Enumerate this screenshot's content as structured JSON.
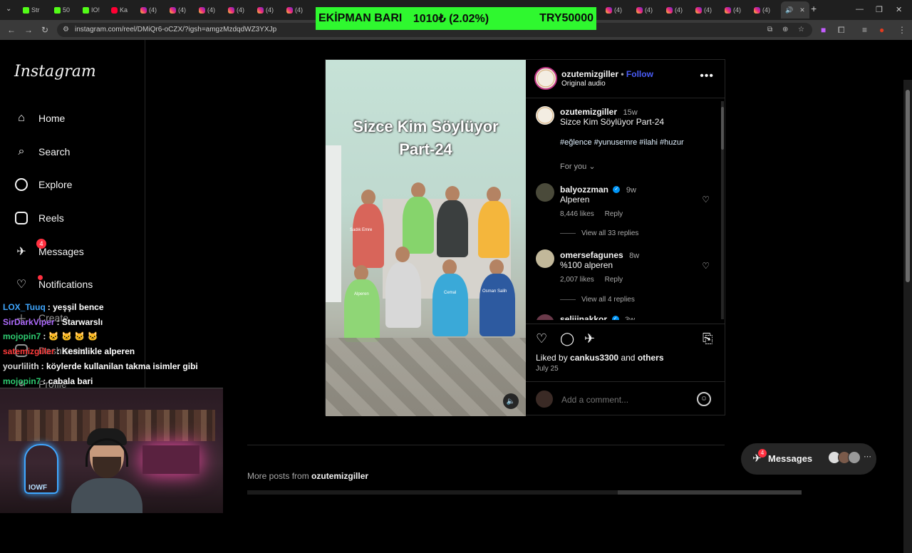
{
  "browser": {
    "tabs": [
      {
        "label": "Str",
        "icon": "kick"
      },
      {
        "label": "50",
        "icon": "kick"
      },
      {
        "label": "IO!",
        "icon": "kick"
      },
      {
        "label": "Ka",
        "icon": "youtube"
      },
      {
        "label": "(4)",
        "icon": "instagram"
      },
      {
        "label": "(4)",
        "icon": "instagram"
      },
      {
        "label": "(4)",
        "icon": "instagram"
      },
      {
        "label": "(4)",
        "icon": "instagram"
      },
      {
        "label": "(4)",
        "icon": "instagram"
      },
      {
        "label": "(4)",
        "icon": "instagram"
      },
      {
        "label": "(4)",
        "icon": "instagram"
      },
      {
        "label": "(4)",
        "icon": "instagram"
      },
      {
        "label": "(4)",
        "icon": "instagram"
      },
      {
        "label": "(4)",
        "icon": "instagram"
      },
      {
        "label": "(4)",
        "icon": "instagram"
      },
      {
        "label": "(4)",
        "icon": "instagram"
      }
    ],
    "url": "instagram.com/reel/DMiQr6-oCZX/?igsh=amgzMzdqdWZ3YXJp",
    "new_tab": "+",
    "minimize": "—",
    "restore": "❐",
    "close": "✕"
  },
  "ticker": {
    "label": "EKİPMAN BARI",
    "amount": "1010₺ (2.02%)",
    "goal": "TRY50000"
  },
  "sidebar": {
    "logo": "Instagram",
    "items": [
      {
        "label": "Home",
        "icon": "home-icon"
      },
      {
        "label": "Search",
        "icon": "search-icon"
      },
      {
        "label": "Explore",
        "icon": "compass-icon"
      },
      {
        "label": "Reels",
        "icon": "reels-icon"
      },
      {
        "label": "Messages",
        "icon": "messenger-icon",
        "badge": "4"
      },
      {
        "label": "Notifications",
        "icon": "heart-icon"
      },
      {
        "label": "Create",
        "icon": "plus-icon"
      },
      {
        "label": "Dashboard",
        "icon": "dashboard-icon"
      },
      {
        "label": "Profile",
        "icon": "profile-icon"
      }
    ]
  },
  "post": {
    "video_title_line1": "Sizce Kim Söylüyor",
    "video_title_line2": "Part-24",
    "kid_names": [
      "Sadık Emre",
      "Alperen",
      "Cemal",
      "Osman Salih"
    ],
    "author": "ozutemizgiller",
    "follow": "Follow",
    "audio": "Original audio",
    "caption": {
      "user": "ozutemizgiller",
      "time": "15w",
      "text": "Sizce Kim Söylüyor Part-24",
      "tags": "#eğlence #yunusemre #ilahi #huzur",
      "for_you": "For you"
    },
    "comments": [
      {
        "user": "balyozzman",
        "verified": true,
        "time": "9w",
        "text": "Alperen",
        "likes": "8,446 likes",
        "reply": "Reply",
        "view_replies": "View all 33 replies"
      },
      {
        "user": "omersefagunes",
        "verified": false,
        "time": "8w",
        "text": "%100 alperen",
        "likes": "2,007 likes",
        "reply": "Reply",
        "view_replies": "View all 4 replies"
      },
      {
        "user": "seliiinakkor",
        "verified": true,
        "time": "3w",
        "text": "",
        "likes": "",
        "reply": "",
        "view_replies": ""
      }
    ],
    "liked_by_prefix": "Liked by",
    "liked_by_user": "cankus3300",
    "liked_by_suffix": "and",
    "liked_by_others": "others",
    "date": "July 25",
    "add_comment_placeholder": "Add a comment..."
  },
  "more_posts": {
    "prefix": "More posts from",
    "user": "ozutemizgiller"
  },
  "messages_bar": {
    "label": "Messages",
    "badge": "4"
  },
  "chat": [
    {
      "user": "LOX_Tuuq",
      "color": "#3fa7ff",
      "text": ": yeşşil bence"
    },
    {
      "user": "SirDarkViper",
      "color": "#b06cff",
      "text": ": Starwarslı"
    },
    {
      "user": "mojopin7",
      "color": "#2ecc71",
      "text": ": 🐱 🐱 🐱 🐱"
    },
    {
      "user": "satemizgiller",
      "color": "#ff3b3b",
      "text": ": Kesinlikle alperen"
    },
    {
      "user": "yourlilith",
      "color": "#d9d9d9",
      "text": ": köylerde kullanilan takma isimler gibi"
    },
    {
      "user": "mojopin7",
      "color": "#2ecc71",
      "text": ": cabala bari"
    }
  ],
  "webcam": {
    "neon_text": "IOWF"
  }
}
